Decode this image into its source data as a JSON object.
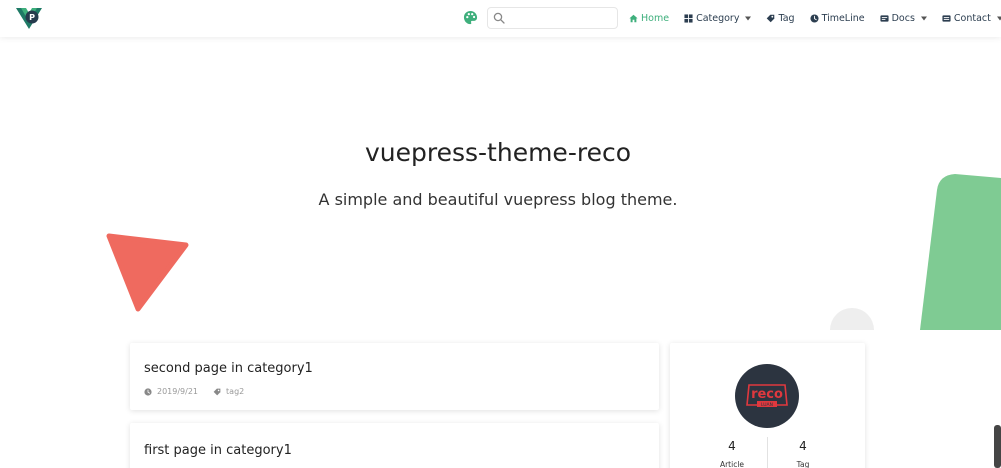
{
  "nav": {
    "search": {
      "value": "",
      "placeholder": ""
    },
    "items": [
      {
        "label": "Home",
        "icon": "home-icon",
        "active": true
      },
      {
        "label": "Category",
        "icon": "category-icon",
        "dropdown": true
      },
      {
        "label": "Tag",
        "icon": "tag-icon"
      },
      {
        "label": "TimeLine",
        "icon": "clock-icon"
      },
      {
        "label": "Docs",
        "icon": "docs-icon",
        "dropdown": true
      },
      {
        "label": "Contact",
        "icon": "contact-icon",
        "dropdown": true
      }
    ]
  },
  "hero": {
    "title": "vuepress-theme-reco",
    "description": "A simple and beautiful vuepress blog theme."
  },
  "posts": [
    {
      "title": "second page in category1",
      "date": "2019/9/21",
      "tag": "tag2"
    },
    {
      "title": "first page in category1"
    }
  ],
  "profile": {
    "avatar_text": "reco",
    "avatar_subtext": "LUAN",
    "stats": [
      {
        "count": "4",
        "label": "Article"
      },
      {
        "count": "4",
        "label": "Tag"
      }
    ]
  },
  "colors": {
    "accent": "#3eaf7c",
    "triangle": "#ef6a5f",
    "green_shape": "#7fcb93",
    "avatar_bg": "#2c3440",
    "avatar_red": "#e0383e"
  }
}
